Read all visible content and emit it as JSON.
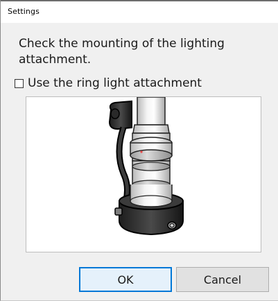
{
  "window": {
    "title": "Settings"
  },
  "message": {
    "text": "Check the mounting of the lighting attachment."
  },
  "options": {
    "ring_light": {
      "label": "Use the ring light attachment",
      "checked": false
    }
  },
  "illustration": {
    "icon": "lens-ring-light-illustration"
  },
  "buttons": {
    "ok_label": "OK",
    "cancel_label": "Cancel"
  },
  "colors": {
    "default_button_border": "#0078d7",
    "default_button_fill": "#e5f1fb"
  }
}
